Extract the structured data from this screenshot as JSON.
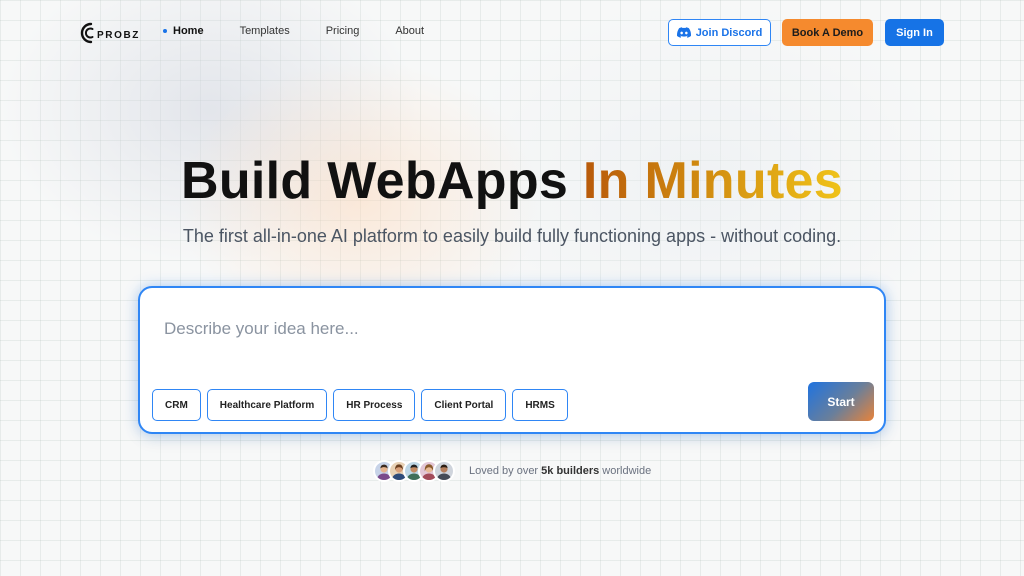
{
  "brand": {
    "name": "PROBZ"
  },
  "nav": {
    "links": [
      {
        "label": "Home",
        "active": true
      },
      {
        "label": "Templates",
        "active": false
      },
      {
        "label": "Pricing",
        "active": false
      },
      {
        "label": "About",
        "active": false
      }
    ],
    "discord_label": "Join Discord",
    "demo_label": "Book A Demo",
    "signin_label": "Sign In"
  },
  "hero": {
    "title_main": "Build WebApps",
    "title_accent": "In Minutes",
    "subtitle": "The first all-in-one AI platform to easily build fully functioning apps - without coding."
  },
  "prompt": {
    "placeholder": "Describe your idea here...",
    "value": "",
    "chips": [
      "CRM",
      "Healthcare Platform",
      "HR Process",
      "Client Portal",
      "HRMS"
    ],
    "start_label": "Start"
  },
  "social": {
    "prefix": "Loved by over ",
    "count": "5k builders",
    "suffix": " worldwide",
    "avatar_count": 5
  },
  "colors": {
    "primary": "#1673e6",
    "accent_orange": "#f58a2e",
    "outline_blue": "#2f86f5",
    "title_gradient": [
      "#b8590a",
      "#f0c31a"
    ]
  },
  "icons": [
    "discord-icon",
    "logo-mark-icon",
    "avatar-icon"
  ]
}
